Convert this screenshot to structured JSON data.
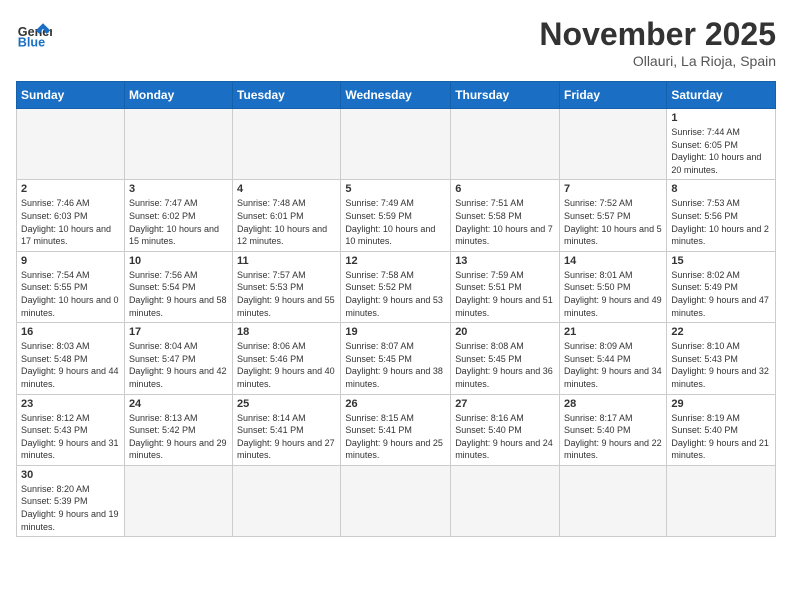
{
  "header": {
    "logo_general": "General",
    "logo_blue": "Blue",
    "month_title": "November 2025",
    "location": "Ollauri, La Rioja, Spain"
  },
  "weekdays": [
    "Sunday",
    "Monday",
    "Tuesday",
    "Wednesday",
    "Thursday",
    "Friday",
    "Saturday"
  ],
  "weeks": [
    [
      {
        "day": "",
        "info": ""
      },
      {
        "day": "",
        "info": ""
      },
      {
        "day": "",
        "info": ""
      },
      {
        "day": "",
        "info": ""
      },
      {
        "day": "",
        "info": ""
      },
      {
        "day": "",
        "info": ""
      },
      {
        "day": "1",
        "info": "Sunrise: 7:44 AM\nSunset: 6:05 PM\nDaylight: 10 hours and 20 minutes."
      }
    ],
    [
      {
        "day": "2",
        "info": "Sunrise: 7:46 AM\nSunset: 6:03 PM\nDaylight: 10 hours and 17 minutes."
      },
      {
        "day": "3",
        "info": "Sunrise: 7:47 AM\nSunset: 6:02 PM\nDaylight: 10 hours and 15 minutes."
      },
      {
        "day": "4",
        "info": "Sunrise: 7:48 AM\nSunset: 6:01 PM\nDaylight: 10 hours and 12 minutes."
      },
      {
        "day": "5",
        "info": "Sunrise: 7:49 AM\nSunset: 5:59 PM\nDaylight: 10 hours and 10 minutes."
      },
      {
        "day": "6",
        "info": "Sunrise: 7:51 AM\nSunset: 5:58 PM\nDaylight: 10 hours and 7 minutes."
      },
      {
        "day": "7",
        "info": "Sunrise: 7:52 AM\nSunset: 5:57 PM\nDaylight: 10 hours and 5 minutes."
      },
      {
        "day": "8",
        "info": "Sunrise: 7:53 AM\nSunset: 5:56 PM\nDaylight: 10 hours and 2 minutes."
      }
    ],
    [
      {
        "day": "9",
        "info": "Sunrise: 7:54 AM\nSunset: 5:55 PM\nDaylight: 10 hours and 0 minutes."
      },
      {
        "day": "10",
        "info": "Sunrise: 7:56 AM\nSunset: 5:54 PM\nDaylight: 9 hours and 58 minutes."
      },
      {
        "day": "11",
        "info": "Sunrise: 7:57 AM\nSunset: 5:53 PM\nDaylight: 9 hours and 55 minutes."
      },
      {
        "day": "12",
        "info": "Sunrise: 7:58 AM\nSunset: 5:52 PM\nDaylight: 9 hours and 53 minutes."
      },
      {
        "day": "13",
        "info": "Sunrise: 7:59 AM\nSunset: 5:51 PM\nDaylight: 9 hours and 51 minutes."
      },
      {
        "day": "14",
        "info": "Sunrise: 8:01 AM\nSunset: 5:50 PM\nDaylight: 9 hours and 49 minutes."
      },
      {
        "day": "15",
        "info": "Sunrise: 8:02 AM\nSunset: 5:49 PM\nDaylight: 9 hours and 47 minutes."
      }
    ],
    [
      {
        "day": "16",
        "info": "Sunrise: 8:03 AM\nSunset: 5:48 PM\nDaylight: 9 hours and 44 minutes."
      },
      {
        "day": "17",
        "info": "Sunrise: 8:04 AM\nSunset: 5:47 PM\nDaylight: 9 hours and 42 minutes."
      },
      {
        "day": "18",
        "info": "Sunrise: 8:06 AM\nSunset: 5:46 PM\nDaylight: 9 hours and 40 minutes."
      },
      {
        "day": "19",
        "info": "Sunrise: 8:07 AM\nSunset: 5:45 PM\nDaylight: 9 hours and 38 minutes."
      },
      {
        "day": "20",
        "info": "Sunrise: 8:08 AM\nSunset: 5:45 PM\nDaylight: 9 hours and 36 minutes."
      },
      {
        "day": "21",
        "info": "Sunrise: 8:09 AM\nSunset: 5:44 PM\nDaylight: 9 hours and 34 minutes."
      },
      {
        "day": "22",
        "info": "Sunrise: 8:10 AM\nSunset: 5:43 PM\nDaylight: 9 hours and 32 minutes."
      }
    ],
    [
      {
        "day": "23",
        "info": "Sunrise: 8:12 AM\nSunset: 5:43 PM\nDaylight: 9 hours and 31 minutes."
      },
      {
        "day": "24",
        "info": "Sunrise: 8:13 AM\nSunset: 5:42 PM\nDaylight: 9 hours and 29 minutes."
      },
      {
        "day": "25",
        "info": "Sunrise: 8:14 AM\nSunset: 5:41 PM\nDaylight: 9 hours and 27 minutes."
      },
      {
        "day": "26",
        "info": "Sunrise: 8:15 AM\nSunset: 5:41 PM\nDaylight: 9 hours and 25 minutes."
      },
      {
        "day": "27",
        "info": "Sunrise: 8:16 AM\nSunset: 5:40 PM\nDaylight: 9 hours and 24 minutes."
      },
      {
        "day": "28",
        "info": "Sunrise: 8:17 AM\nSunset: 5:40 PM\nDaylight: 9 hours and 22 minutes."
      },
      {
        "day": "29",
        "info": "Sunrise: 8:19 AM\nSunset: 5:40 PM\nDaylight: 9 hours and 21 minutes."
      }
    ],
    [
      {
        "day": "30",
        "info": "Sunrise: 8:20 AM\nSunset: 5:39 PM\nDaylight: 9 hours and 19 minutes."
      },
      {
        "day": "",
        "info": ""
      },
      {
        "day": "",
        "info": ""
      },
      {
        "day": "",
        "info": ""
      },
      {
        "day": "",
        "info": ""
      },
      {
        "day": "",
        "info": ""
      },
      {
        "day": "",
        "info": ""
      }
    ]
  ]
}
